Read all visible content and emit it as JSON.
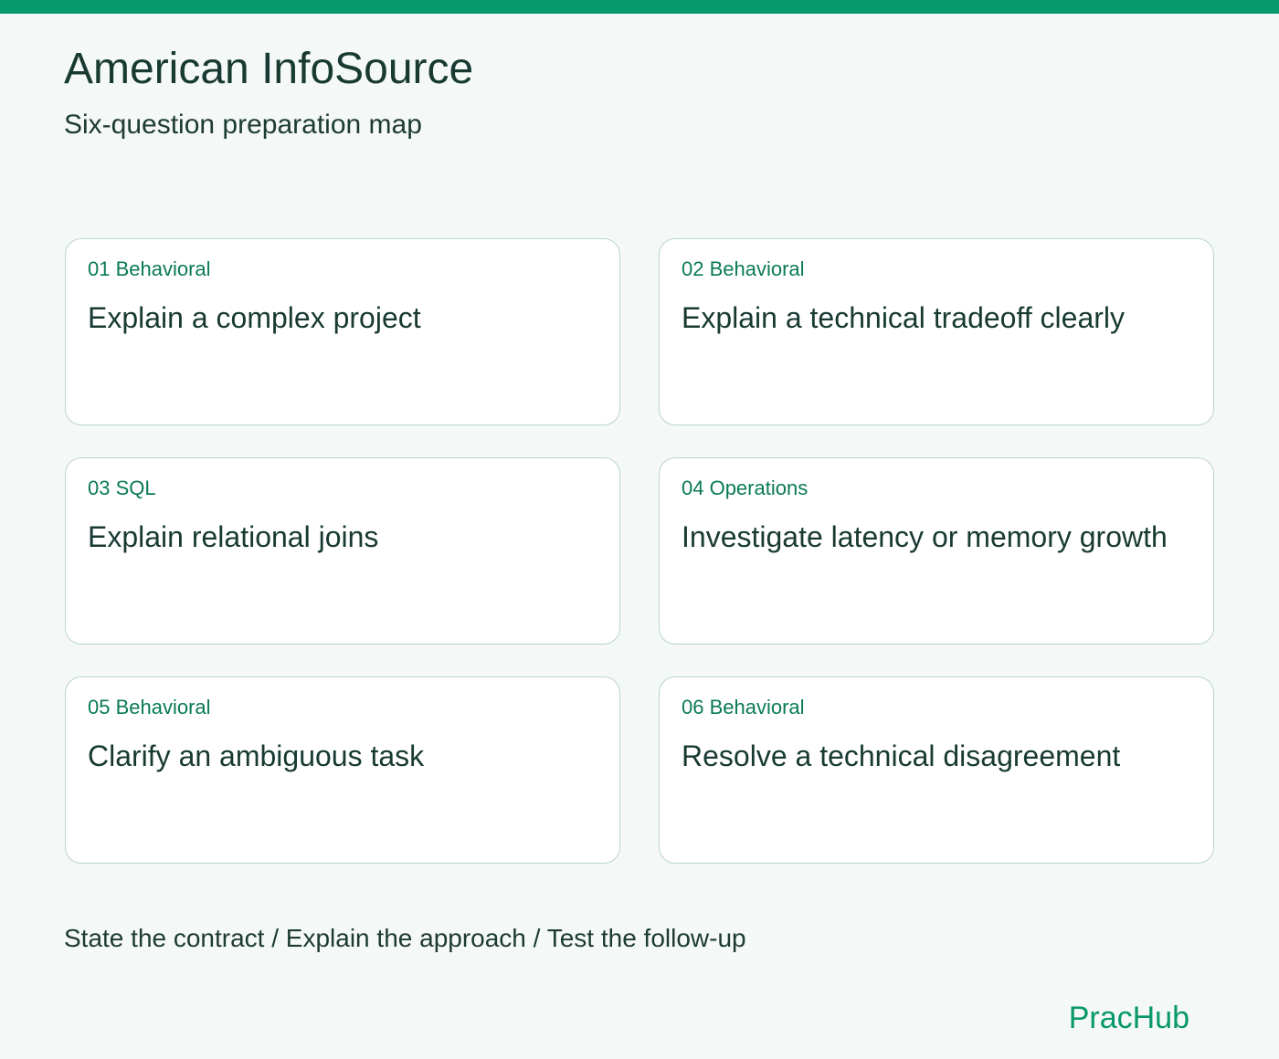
{
  "header": {
    "title": "American InfoSource",
    "subtitle": "Six-question preparation map"
  },
  "questions": [
    {
      "tag": "01 Behavioral",
      "title": "Explain a complex project"
    },
    {
      "tag": "02 Behavioral",
      "title": "Explain a technical tradeoff clearly"
    },
    {
      "tag": "03 SQL",
      "title": "Explain relational joins"
    },
    {
      "tag": "04 Operations",
      "title": "Investigate latency or memory growth"
    },
    {
      "tag": "05 Behavioral",
      "title": "Clarify an ambiguous task"
    },
    {
      "tag": "06 Behavioral",
      "title": "Resolve a technical disagreement"
    }
  ],
  "footer": {
    "note": "State the contract / Explain the approach / Test the follow-up",
    "brand": "PracHub"
  },
  "colors": {
    "accent": "#07986b",
    "tag_text": "#0a7a56",
    "card_border": "#b9d6cb",
    "page_background": "#f4f8f6",
    "text_primary": "#183a32"
  }
}
